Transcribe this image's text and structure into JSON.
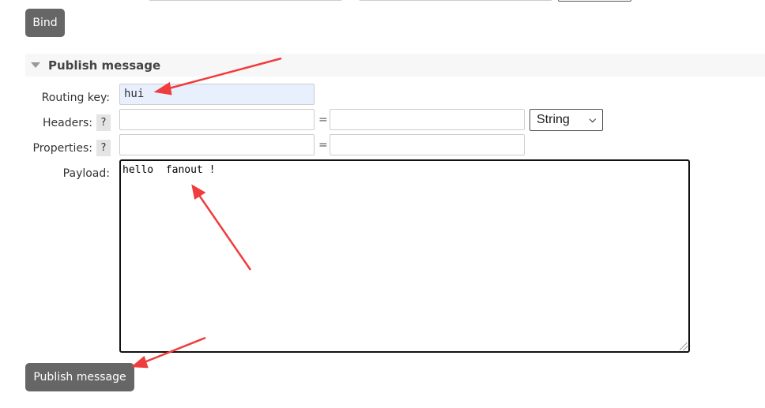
{
  "bind_button": "Bind",
  "section": {
    "title": "Publish message"
  },
  "form": {
    "routing_key_label": "Routing key:",
    "routing_key_value": "hui",
    "headers_label": "Headers:",
    "headers_help": "?",
    "headers_type": "String",
    "properties_label": "Properties:",
    "properties_help": "?",
    "equals": "=",
    "payload_label": "Payload:",
    "payload_value": "hello  fanout !"
  },
  "publish_button": "Publish message",
  "colors": {
    "button": "#666666",
    "routing_key_bg": "#e8f0fe",
    "annotation": "#f03c3c"
  }
}
